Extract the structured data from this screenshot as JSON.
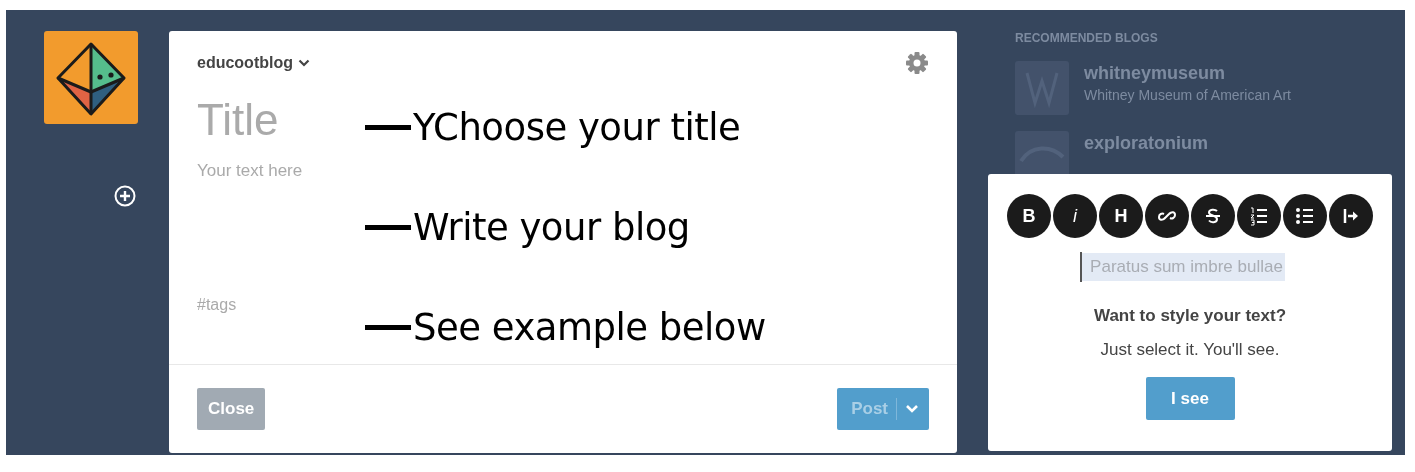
{
  "sidebar": {
    "create_button": {
      "kind": "plus"
    }
  },
  "editor": {
    "blog_name": "educootblog",
    "title_placeholder": "Title",
    "body_placeholder": "Your text here",
    "tags_placeholder": "#tags",
    "close_button": {
      "label": "Close"
    },
    "post_button": {
      "label": "Post",
      "disabled": true
    }
  },
  "annotations": [
    {
      "text": "YChoose your title"
    },
    {
      "text": "Write your blog"
    },
    {
      "text": "See example below"
    }
  ],
  "background_panel": {
    "heading": "RECOMMENDED BLOGS",
    "blogs": [
      {
        "name": "whitneymuseum",
        "description": "Whitney Museum of American Art"
      },
      {
        "name": "exploratonium"
      }
    ]
  },
  "tip": {
    "toolbar": [
      {
        "kind": "bold",
        "label": "B"
      },
      {
        "kind": "italic",
        "label": "i"
      },
      {
        "kind": "heading",
        "label": "H"
      },
      {
        "kind": "link"
      },
      {
        "kind": "strike"
      },
      {
        "kind": "ordered-list"
      },
      {
        "kind": "bullet-list"
      },
      {
        "kind": "more"
      }
    ],
    "sample_text": "Paratus sum imbre bullae",
    "heading": "Want to style your text?",
    "message": "Just select it. You'll see.",
    "button": "I see"
  }
}
